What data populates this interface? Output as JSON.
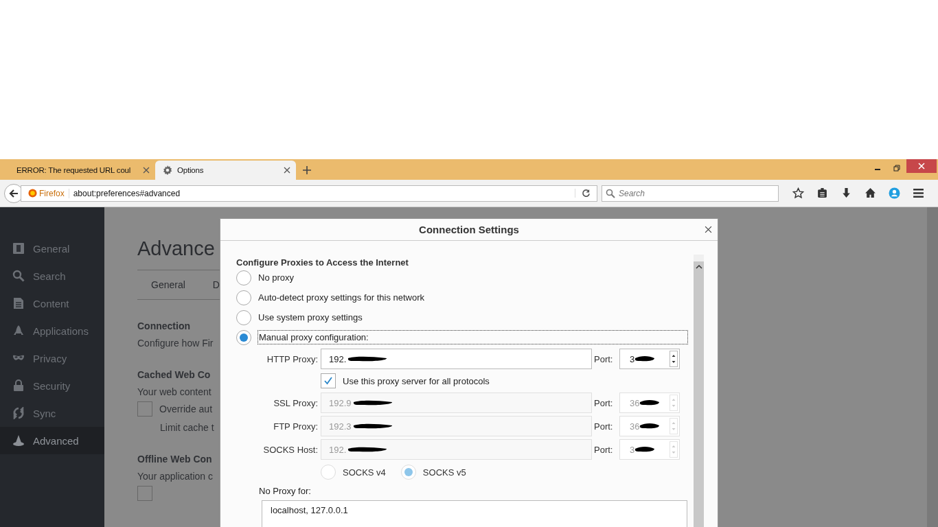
{
  "browser": {
    "tabs": [
      {
        "title": "ERROR: The requested URL coul",
        "selected": false,
        "kind": "page"
      },
      {
        "title": "Options",
        "selected": true,
        "kind": "settings"
      }
    ],
    "address_bar": {
      "identity": "Firefox",
      "url": "about:preferences#advanced"
    },
    "search": {
      "placeholder": "Search"
    }
  },
  "sidebar": {
    "items": [
      {
        "label": "General",
        "kind": "general",
        "selected": false
      },
      {
        "label": "Search",
        "kind": "search",
        "selected": false
      },
      {
        "label": "Content",
        "kind": "content",
        "selected": false
      },
      {
        "label": "Applications",
        "kind": "applications",
        "selected": false
      },
      {
        "label": "Privacy",
        "kind": "privacy",
        "selected": false
      },
      {
        "label": "Security",
        "kind": "security",
        "selected": false
      },
      {
        "label": "Sync",
        "kind": "sync",
        "selected": false
      },
      {
        "label": "Advanced",
        "kind": "advanced",
        "selected": true
      }
    ]
  },
  "page": {
    "title": "Advance",
    "tabs": [
      "General",
      "D"
    ],
    "sections": [
      {
        "heading": "Connection",
        "text": "Configure how Fir"
      },
      {
        "heading": "Cached Web Co",
        "text": "Your web content",
        "checkbox": {
          "label": "Override aut",
          "checked": false
        },
        "note": "Limit cache t"
      },
      {
        "heading": "Offline Web Con",
        "text": "Your application c",
        "checkbox": {
          "checked": false
        }
      }
    ]
  },
  "dialog": {
    "title": "Connection Settings",
    "heading": "Configure Proxies to Access the Internet",
    "modes": [
      {
        "label": "No proxy",
        "selected": false
      },
      {
        "label": "Auto-detect proxy settings for this network",
        "selected": false
      },
      {
        "label": "Use system proxy settings",
        "selected": false
      },
      {
        "label": "Manual proxy configuration:",
        "selected": true
      }
    ],
    "proxies": [
      {
        "label": "HTTP Proxy:",
        "value": "192.",
        "port_label": "Port:",
        "port": "3",
        "disabled": false
      },
      {
        "label": "SSL Proxy:",
        "value": "192.9",
        "port_label": "Port:",
        "port": "36",
        "disabled": true
      },
      {
        "label": "FTP Proxy:",
        "value": "192.3",
        "port_label": "Port:",
        "port": "36",
        "disabled": true
      },
      {
        "label": "SOCKS Host:",
        "value": "192.",
        "port_label": "Port:",
        "port": "3",
        "disabled": true
      }
    ],
    "share_all": {
      "label": "Use this proxy server for all protocols",
      "checked": true
    },
    "socks_versions": [
      {
        "label": "SOCKS v4",
        "selected": false
      },
      {
        "label": "SOCKS v5",
        "selected": true
      }
    ],
    "no_proxy": {
      "label": "No Proxy for:",
      "value": "localhost, 127.0.0.1"
    }
  }
}
